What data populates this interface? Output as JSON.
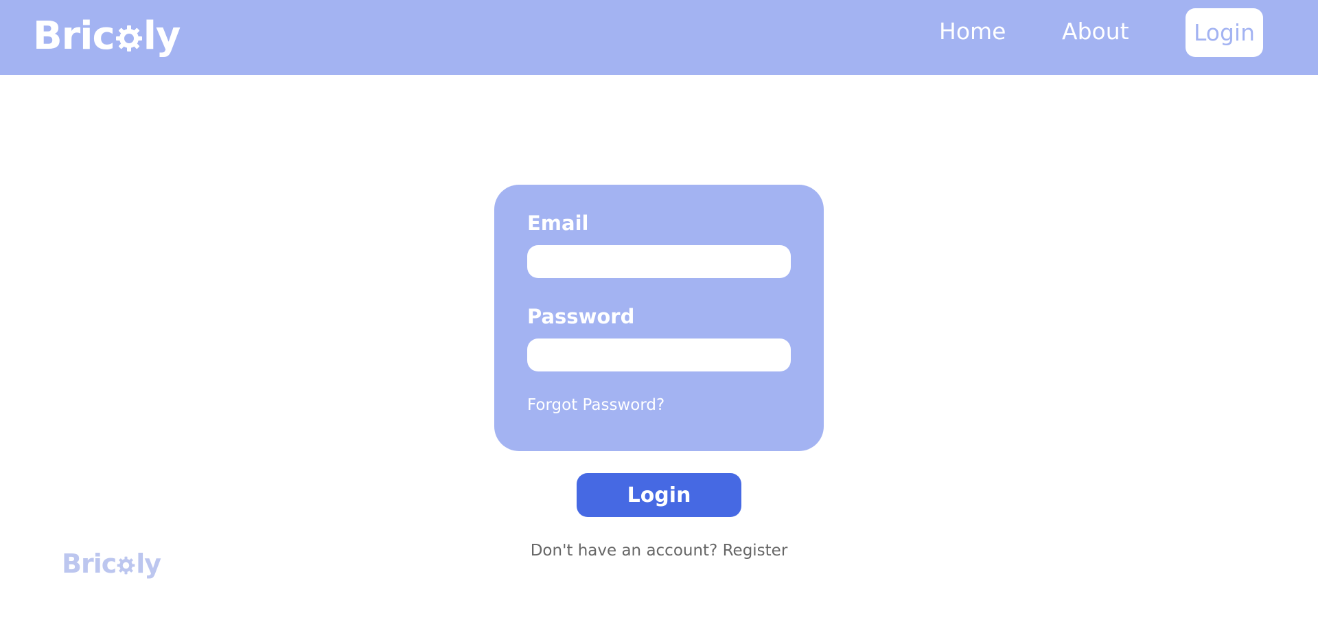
{
  "header": {
    "logo": {
      "prefix": "Bric",
      "suffix": "ly"
    },
    "nav": {
      "home": "Home",
      "about": "About",
      "login": "Login"
    }
  },
  "form": {
    "email_label": "Email",
    "email_value": "",
    "password_label": "Password",
    "password_value": "",
    "forgot_password": "Forgot Password?",
    "submit_label": "Login"
  },
  "register": {
    "prompt": "Don't have an account?",
    "link": "Register"
  },
  "footer": {
    "logo": {
      "prefix": "Bric",
      "suffix": "ly"
    }
  },
  "colors": {
    "brand_light": "#a3b3f2",
    "brand_primary": "#4669e3",
    "text_muted": "#666666",
    "background": "#ffffff"
  }
}
